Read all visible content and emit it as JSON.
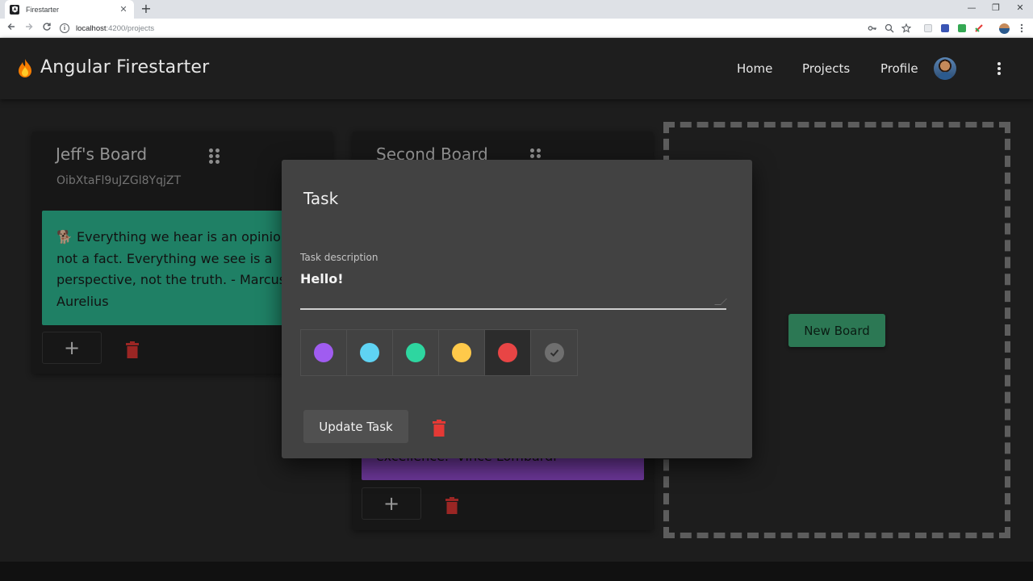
{
  "browser": {
    "tab_title": "Firestarter",
    "tab_close": "✕",
    "new_tab": "+",
    "url_host": "localhost",
    "url_path": ":4200/projects",
    "window_controls": [
      "—",
      "❐",
      "✕"
    ],
    "icons": [
      "back-icon",
      "forward-icon",
      "reload-icon",
      "info-icon",
      "key-icon",
      "zoom-icon",
      "star-icon",
      "extension-icon",
      "menu-icon"
    ]
  },
  "header": {
    "app_title": "Angular Firestarter",
    "nav": [
      "Home",
      "Projects",
      "Profile"
    ]
  },
  "boards": [
    {
      "title": "Jeff's Board",
      "id": "OibXtaFl9uJZGl8YqjZT",
      "task": "🐕 Everything we hear is an opinion, not a fact. Everything we see is a perspective, not the truth. - Marcus Aurelius",
      "task_color": "#2ebd95"
    },
    {
      "title": "Second Board",
      "task": "excellence. -Vince Lombardi",
      "task_color": "#a052e0"
    }
  ],
  "add_label": "+",
  "new_board_label": "New Board",
  "dialog": {
    "title": "Task",
    "field_label": "Task description",
    "field_value": "Hello!",
    "colors": [
      "#a05cf0",
      "#5fd3f3",
      "#2ed6a0",
      "#ffc94a",
      "#e84545"
    ],
    "selected_color": "#e84545",
    "update_label": "Update Task"
  },
  "colors": {
    "accent_green": "#42b27d",
    "danger_red": "#e53935",
    "header_bg": "#1e1e1e",
    "page_bg": "#2b2b2b",
    "dialog_bg": "#424242"
  }
}
